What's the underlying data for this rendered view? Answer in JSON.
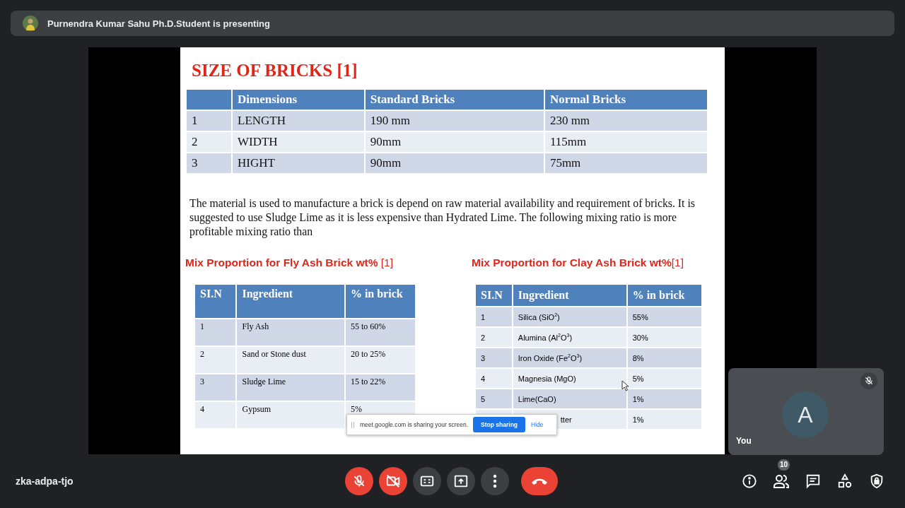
{
  "presenter_bar": {
    "text": "Purnendra Kumar Sahu Ph.D.Student is presenting"
  },
  "slide": {
    "title": "SIZE OF BRICKS [1]",
    "size_table": {
      "columns": [
        "Dimensions",
        "Standard Bricks",
        "Normal Bricks"
      ],
      "rows": [
        {
          "sl": "1",
          "cells": [
            "LENGTH",
            "190 mm",
            "230 mm"
          ]
        },
        {
          "sl": "2",
          "cells": [
            "WIDTH",
            "90mm",
            "115mm"
          ]
        },
        {
          "sl": "3",
          "cells": [
            "HIGHT",
            "90mm",
            "75mm"
          ]
        }
      ]
    },
    "paragraph": "The material is used to manufacture a brick is depend on raw material availability and requirement of bricks. It is suggested to use Sludge Lime as it is less expensive than Hydrated Lime. The following  mixing ratio is more profitable mixing ratio than",
    "fly_ash": {
      "heading": "**Mix Proportion for Fly Ash Brick  wt%** [1]",
      "columns": [
        "SI.N",
        "Ingredient",
        "% in brick"
      ],
      "rows": [
        {
          "sl": "1",
          "ingredient": "Fly Ash",
          "percent": "55 to 60%"
        },
        {
          "sl": "2",
          "ingredient": "Sand or Stone dust",
          "percent": "20 to 25%"
        },
        {
          "sl": "3",
          "ingredient": "Sludge Lime",
          "percent": "15 to 22%"
        },
        {
          "sl": "4",
          "ingredient": "Gypsum",
          "percent": "5%"
        }
      ]
    },
    "clay_ash": {
      "heading": "**Mix Proportion for Clay Ash Brick wt%**[1]",
      "columns": [
        "SI.N",
        "Ingredient",
        "% in brick"
      ],
      "rows": [
        {
          "sl": "1",
          "ingredient": "Silica (SiO$^{2}$)",
          "percent": "55%"
        },
        {
          "sl": "2",
          "ingredient": "Alumina (Al$^{2}$O$^{3}$)",
          "percent": "30%"
        },
        {
          "sl": "3",
          "ingredient": "Iron Oxide (Fe$^{2}$O$^{3}$)",
          "percent": "8%"
        },
        {
          "sl": "4",
          "ingredient": "Magnesia (MgO)",
          "percent": "5%"
        },
        {
          "sl": "5",
          "ingredient": "Lime(CaO)",
          "percent": "1%"
        },
        {
          "kind": "covered",
          "ingredient": "tter",
          "percent": "1%"
        }
      ]
    }
  },
  "sharing_bar": {
    "message": "meet.google.com is sharing your screen.",
    "stop_button": "Stop sharing",
    "hide_link": "Hide"
  },
  "self_tile": {
    "avatar_letter": "A",
    "name": "You",
    "muted": true
  },
  "meeting_code": "zka-adpa-tjo",
  "controls": [
    {
      "kind": "mic",
      "on": false
    },
    {
      "kind": "camera",
      "on": false
    },
    {
      "kind": "captions",
      "on": false
    },
    {
      "kind": "present"
    },
    {
      "kind": "more"
    },
    {
      "kind": "leave"
    }
  ],
  "side_buttons": [
    {
      "kind": "info"
    },
    {
      "kind": "people",
      "badge": "10"
    },
    {
      "kind": "chat"
    },
    {
      "kind": "activities"
    },
    {
      "kind": "host"
    }
  ]
}
